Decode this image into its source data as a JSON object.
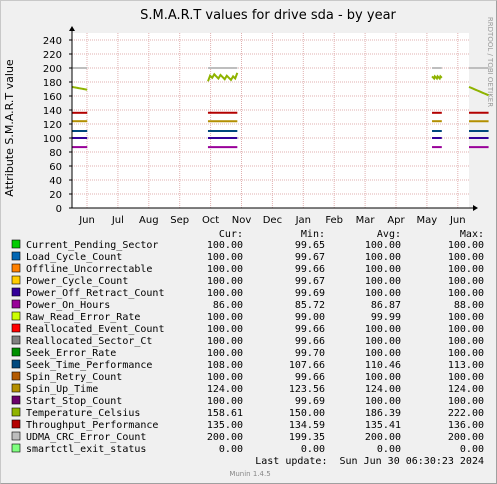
{
  "chart_data": {
    "type": "line",
    "title": "S.M.A.R.T values for drive sda - by year",
    "ylabel": "Attribute S.M.A.R.T value",
    "ylim": [
      0,
      250
    ],
    "yticks": [
      "0",
      "20",
      "40",
      "60",
      "80",
      "100",
      "120",
      "140",
      "160",
      "180",
      "200",
      "220",
      "240"
    ],
    "xticks": [
      "Jun",
      "Jul",
      "Aug",
      "Sep",
      "Oct",
      "Nov",
      "Dec",
      "Jan",
      "Feb",
      "Mar",
      "Apr",
      "May",
      "Jun"
    ],
    "grid": true,
    "x_domain": [
      0,
      365
    ],
    "segments": [
      [
        0,
        14
      ],
      [
        125,
        152
      ],
      [
        331,
        340
      ],
      [
        365,
        383
      ]
    ],
    "columns": [
      "Cur:",
      "Min:",
      "Avg:",
      "Max:"
    ],
    "series": [
      {
        "name": "Current_Pending_Sector",
        "color": "#00cc00",
        "cur": "100.00",
        "min": "99.65",
        "avg": "100.00",
        "max": "100.00",
        "level": 100,
        "show": false
      },
      {
        "name": "Load_Cycle_Count",
        "color": "#0066b3",
        "cur": "100.00",
        "min": "99.67",
        "avg": "100.00",
        "max": "100.00",
        "level": 100,
        "show": false
      },
      {
        "name": "Offline_Uncorrectable",
        "color": "#ff8000",
        "cur": "100.00",
        "min": "99.66",
        "avg": "100.00",
        "max": "100.00",
        "level": 100,
        "show": false
      },
      {
        "name": "Power_Cycle_Count",
        "color": "#ffcc00",
        "cur": "100.00",
        "min": "99.67",
        "avg": "100.00",
        "max": "100.00",
        "level": 100,
        "show": false
      },
      {
        "name": "Power_Off_Retract_Count",
        "color": "#330099",
        "cur": "100.00",
        "min": "99.69",
        "avg": "100.00",
        "max": "100.00",
        "level": 100,
        "show": true
      },
      {
        "name": "Power_On_Hours",
        "color": "#990099",
        "cur": "86.00",
        "min": "85.72",
        "avg": "86.87",
        "max": "88.00",
        "level": 87,
        "show": true
      },
      {
        "name": "Raw_Read_Error_Rate",
        "color": "#ccff00",
        "cur": "100.00",
        "min": "99.00",
        "avg": "99.99",
        "max": "100.00",
        "level": 100,
        "show": false
      },
      {
        "name": "Reallocated_Event_Count",
        "color": "#ff0000",
        "cur": "100.00",
        "min": "99.66",
        "avg": "100.00",
        "max": "100.00",
        "level": 100,
        "show": false
      },
      {
        "name": "Reallocated_Sector_Ct",
        "color": "#808080",
        "cur": "100.00",
        "min": "99.66",
        "avg": "100.00",
        "max": "100.00",
        "level": 100,
        "show": false
      },
      {
        "name": "Seek_Error_Rate",
        "color": "#008f00",
        "cur": "100.00",
        "min": "99.70",
        "avg": "100.00",
        "max": "100.00",
        "level": 100,
        "show": false
      },
      {
        "name": "Seek_Time_Performance",
        "color": "#00487d",
        "cur": "108.00",
        "min": "107.66",
        "avg": "110.46",
        "max": "113.00",
        "level": 110,
        "show": true
      },
      {
        "name": "Spin_Retry_Count",
        "color": "#b35a00",
        "cur": "100.00",
        "min": "99.66",
        "avg": "100.00",
        "max": "100.00",
        "level": 100,
        "show": false
      },
      {
        "name": "Spin_Up_Time",
        "color": "#b38f00",
        "cur": "124.00",
        "min": "123.56",
        "avg": "124.00",
        "max": "124.00",
        "level": 124,
        "show": true
      },
      {
        "name": "Start_Stop_Count",
        "color": "#6b006b",
        "cur": "100.00",
        "min": "99.69",
        "avg": "100.00",
        "max": "100.00",
        "level": 100,
        "show": false
      },
      {
        "name": "Temperature_Celsius",
        "color": "#8fb300",
        "cur": "158.61",
        "min": "150.00",
        "avg": "186.39",
        "max": "222.00",
        "level": 190,
        "show": true
      },
      {
        "name": "Throughput_Performance",
        "color": "#b30000",
        "cur": "135.00",
        "min": "134.59",
        "avg": "135.41",
        "max": "136.00",
        "level": 136,
        "show": true
      },
      {
        "name": "UDMA_CRC_Error_Count",
        "color": "#bebebe",
        "cur": "200.00",
        "min": "199.35",
        "avg": "200.00",
        "max": "200.00",
        "level": 200,
        "show": true
      },
      {
        "name": "smartctl_exit_status",
        "color": "#80ff80",
        "cur": "0.00",
        "min": "0.00",
        "avg": "0.00",
        "max": "0.00",
        "level": 0,
        "show": false
      }
    ],
    "last_update": "Last update:  Sun Jun 30 06:30:23 2024",
    "watermark": "RRDTOOL / TOBI OETIKER",
    "footer": "Munin 1.4.5"
  }
}
